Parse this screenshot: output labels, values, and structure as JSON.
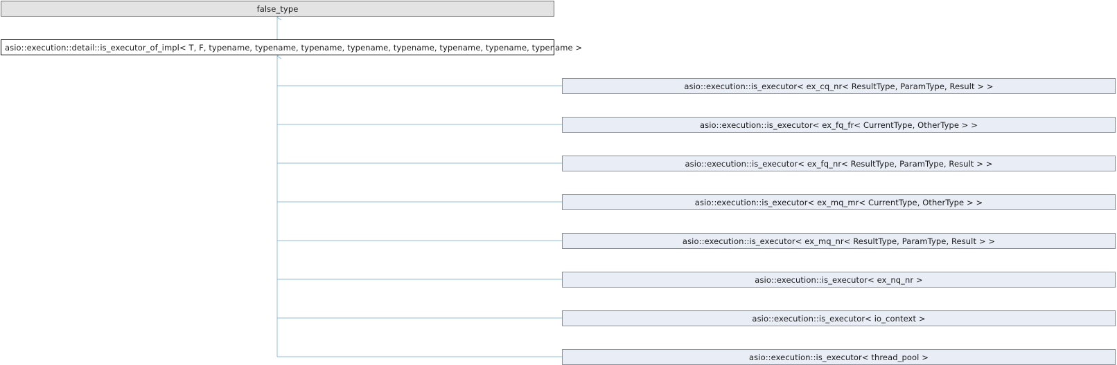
{
  "diagram": {
    "base": {
      "label": "false_type"
    },
    "current": {
      "label": "asio::execution::detail::is_executor_of_impl< T, F, typename, typename, typename, typename, typename, typename, typename, typename >"
    },
    "derived": [
      {
        "label": "asio::execution::is_executor< ex_cq_nr< ResultType, ParamType, Result > >"
      },
      {
        "label": "asio::execution::is_executor< ex_fq_fr< CurrentType, OtherType > >"
      },
      {
        "label": "asio::execution::is_executor< ex_fq_nr< ResultType, ParamType, Result > >"
      },
      {
        "label": "asio::execution::is_executor< ex_mq_mr< CurrentType, OtherType > >"
      },
      {
        "label": "asio::execution::is_executor< ex_mq_nr< ResultType, ParamType, Result > >"
      },
      {
        "label": "asio::execution::is_executor< ex_nq_nr >"
      },
      {
        "label": "asio::execution::is_executor< io_context >"
      },
      {
        "label": "asio::execution::is_executor< thread_pool >"
      }
    ],
    "colors": {
      "edge": "#8cbedc",
      "derived_fill": "#e8edf6",
      "base_fill": "#e3e3e3"
    }
  }
}
